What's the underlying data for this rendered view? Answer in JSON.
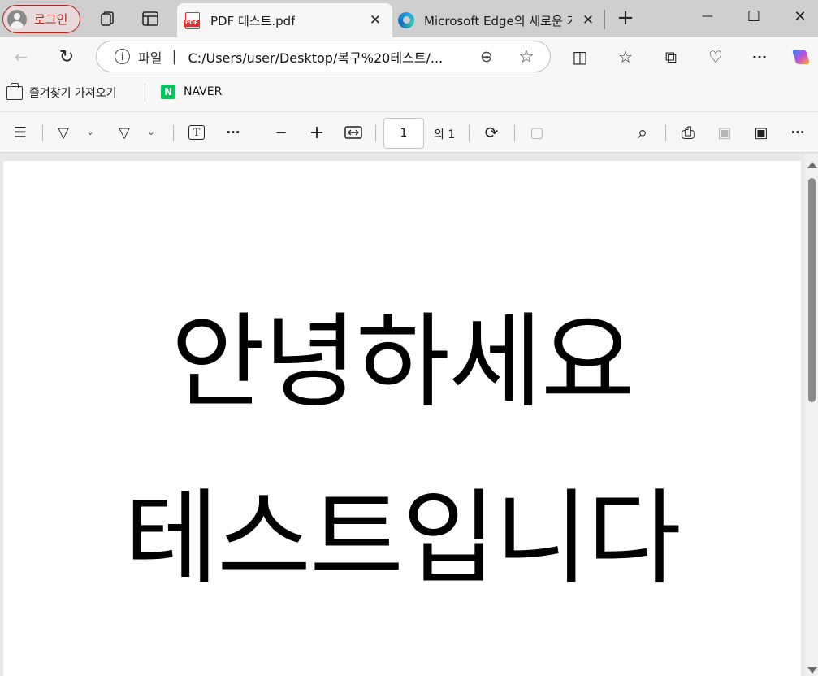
{
  "tabstrip": {
    "profile_label": "로그인",
    "tabs": [
      {
        "title": "PDF 테스트.pdf",
        "close": "✕"
      },
      {
        "title": "Microsoft Edge의 새로운 기",
        "close": "✕"
      }
    ],
    "new_tab": "+",
    "minimize": "—",
    "maximize": "☐",
    "close_window": "✕"
  },
  "navbar": {
    "back": "←",
    "refresh": "↻",
    "address_scheme": "파일",
    "address_divider": "|",
    "address_url": "C:/Users/user/Desktop/복구%20테스트/...",
    "zoom": "⊖",
    "favorite": "☆",
    "split": "◫",
    "favorites": "☆",
    "collections": "⧉",
    "health": "♡",
    "more": "···"
  },
  "favorites_bar": {
    "import_label": "즐겨찾기 가져오기",
    "naver_label": "NAVER",
    "naver_icon": "N"
  },
  "pdf_toolbar": {
    "contents": "☰",
    "highlight": "▽",
    "draw": "▽",
    "chevron": "⌄",
    "textbox": "T",
    "more_tools": "···",
    "zoom_out": "−",
    "zoom_in": "+",
    "fit": "↔",
    "page_number": "1",
    "page_total": "의 1",
    "rotate": "⟳",
    "two_page": "▢",
    "search": "⌕",
    "print": "⎙",
    "save": "▣",
    "save_as": "▣",
    "more": "···"
  },
  "document": {
    "line1": "안녕하세요",
    "line2": "테스트입니다"
  },
  "colors": {
    "accent_red": "#b3261e",
    "naver_green": "#03c75a",
    "tabstrip_bg": "#cfcfcf"
  }
}
